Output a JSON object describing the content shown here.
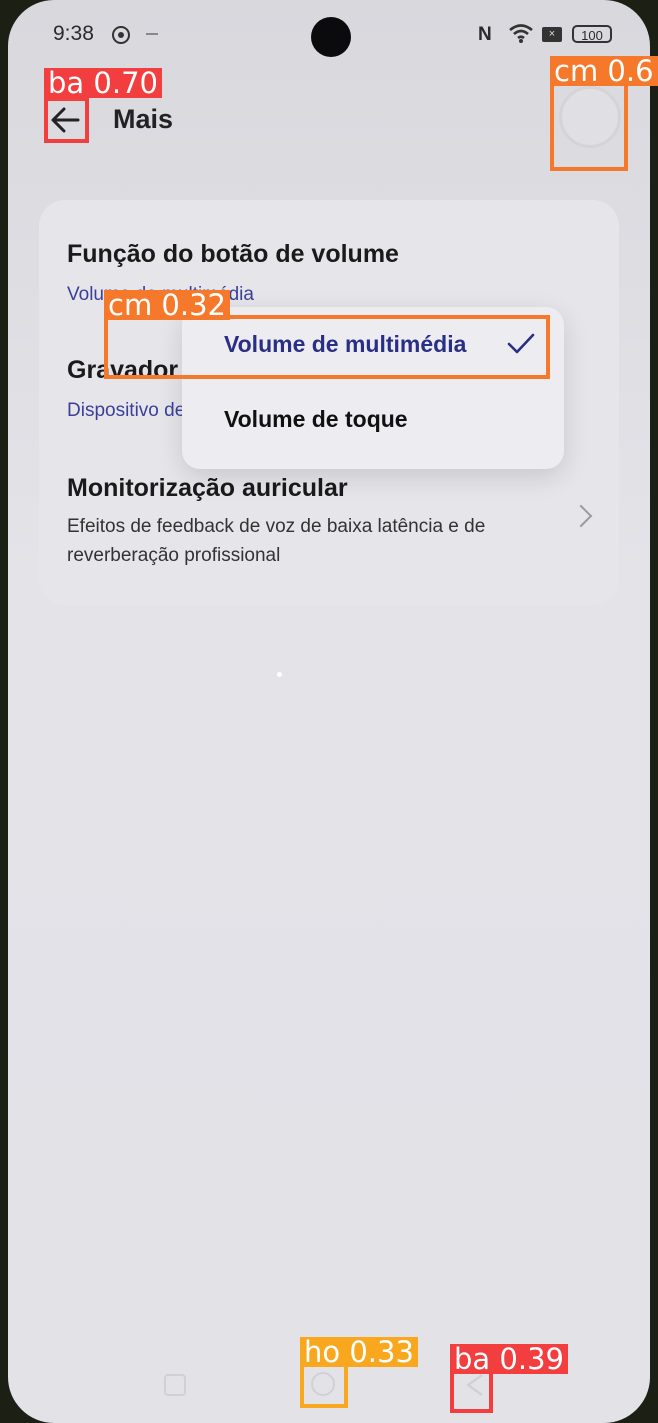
{
  "status_bar": {
    "time": "9:38",
    "nfc": "N",
    "sim": "×",
    "battery": "100"
  },
  "app_bar": {
    "title": "Mais"
  },
  "settings": [
    {
      "title": "Função do botão de volume",
      "subtitle": "Volume de multimédia"
    },
    {
      "title": "Gravador",
      "subtitle": "Dispositivo de gravação"
    },
    {
      "title": "Monitorização auricular",
      "description": "Efeitos de feedback de voz de baixa latência e de reverberação profissional"
    }
  ],
  "popup_menu": {
    "options": [
      {
        "label": "Volume de multimédia",
        "selected": true
      },
      {
        "label": "Volume de toque",
        "selected": false
      }
    ]
  },
  "detections": [
    {
      "label": "ba 0.70"
    },
    {
      "label": "cm 0.6"
    },
    {
      "label": "cm 0.32"
    },
    {
      "label": "ho 0.33"
    },
    {
      "label": "ba 0.39"
    }
  ],
  "colors": {
    "accent": "#2a2f86",
    "subtitle": "#3c3f9a",
    "detection_red": "#f23e3e",
    "detection_orange": "#f6782b",
    "detection_yellow": "#f9a71e"
  },
  "icons": [
    "gear-icon",
    "nfc-icon",
    "wifi-icon",
    "battery-icon",
    "back-arrow-icon",
    "checkmark-icon",
    "chevron-right-icon",
    "recent-apps-icon",
    "home-icon",
    "nav-back-icon"
  ]
}
